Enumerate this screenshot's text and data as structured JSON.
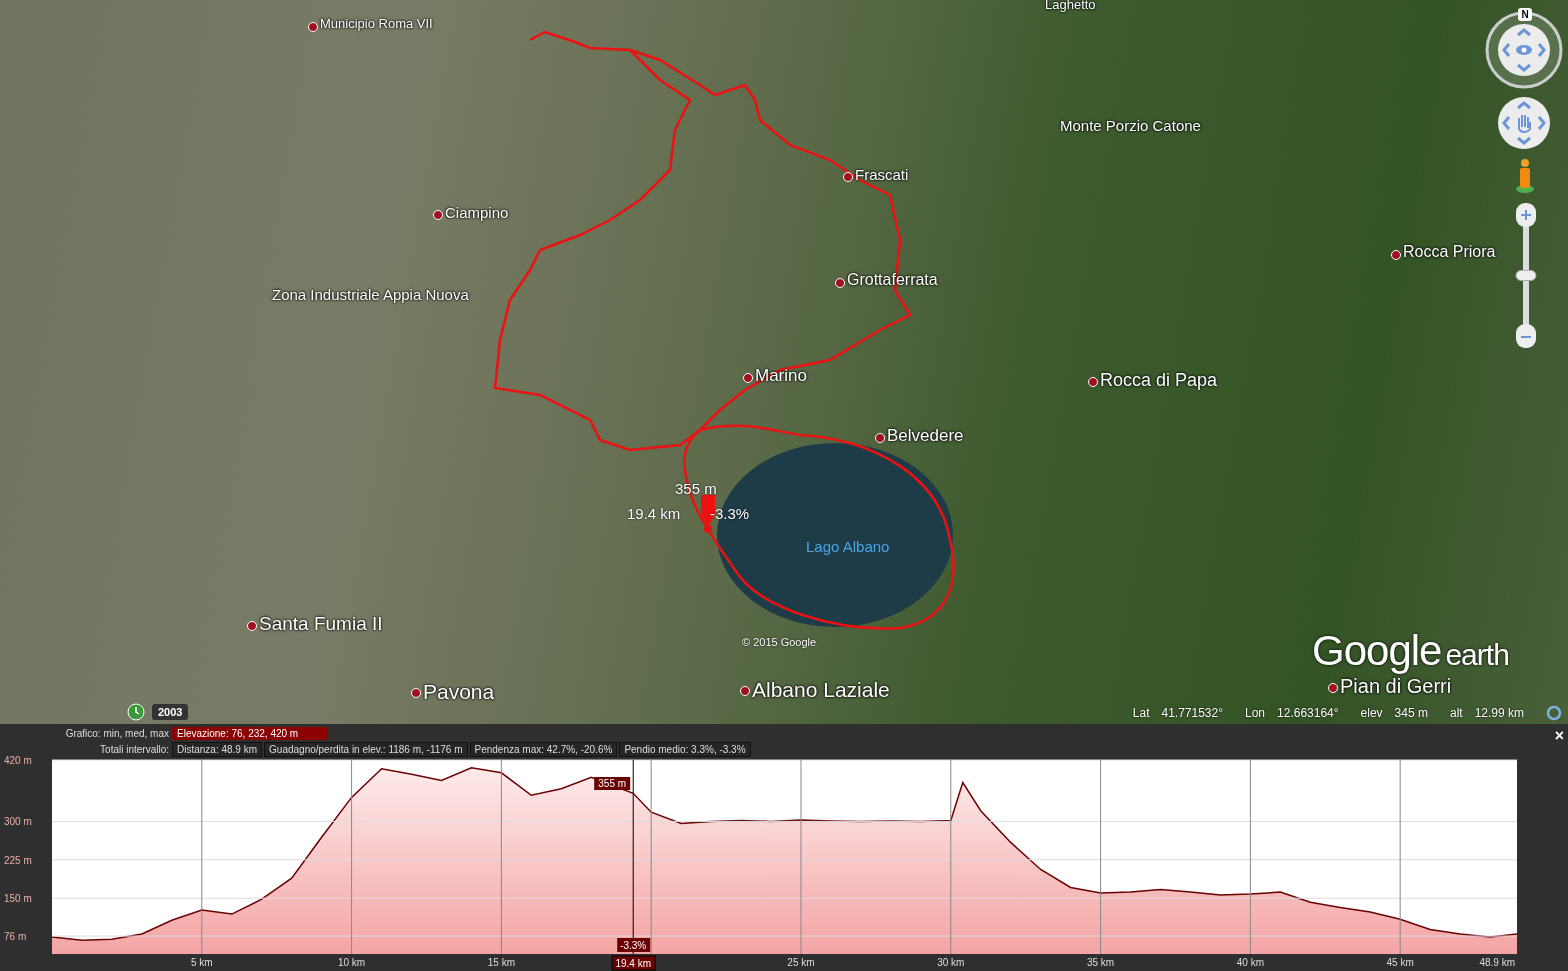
{
  "map": {
    "places": [
      {
        "name": "Laghetto",
        "kind": "locality"
      },
      {
        "name": "Municipio Roma VII",
        "kind": "town"
      },
      {
        "name": "Monte Porzio Catone",
        "kind": "locality"
      },
      {
        "name": "Frascati",
        "kind": "town"
      },
      {
        "name": "Ciampino",
        "kind": "town"
      },
      {
        "name": "Grottaferrata",
        "kind": "town"
      },
      {
        "name": "Rocca Priora",
        "kind": "town"
      },
      {
        "name": "Zona Industriale Appia Nuova",
        "kind": "locality"
      },
      {
        "name": "Marino",
        "kind": "town"
      },
      {
        "name": "Rocca di Papa",
        "kind": "town"
      },
      {
        "name": "Belvedere",
        "kind": "town"
      },
      {
        "name": "Lago Albano",
        "kind": "water"
      },
      {
        "name": "Santa Fumia II",
        "kind": "town"
      },
      {
        "name": "Pavona",
        "kind": "town"
      },
      {
        "name": "Albano Laziale",
        "kind": "town"
      },
      {
        "name": "Pian di Gerri",
        "kind": "town"
      }
    ],
    "marker": {
      "elevation": "355 m",
      "distance": "19.4 km",
      "slope": "-3.3%"
    },
    "zoom_slider": {
      "level": 0.5
    },
    "copyright": "© 2015 Google",
    "logo_word": "Google",
    "logo_suffix": "earth",
    "historical_year": "2003",
    "compass_letter": "N"
  },
  "status_bar": [
    {
      "label": "Lat",
      "value": "41.771532°"
    },
    {
      "label": "Lon",
      "value": "12.663164°"
    },
    {
      "label": "elev",
      "value": "345 m"
    },
    {
      "label": "alt",
      "value": "12.99 km"
    }
  ],
  "elevation_profile": {
    "graph_label": "Grafico: min, med, max",
    "graph_value": "Elevazione: 76, 232, 420 m",
    "totals_label": "Totali intervallo:",
    "totals": [
      "Distanza: 48.9 km",
      "Guadagno/perdita in elev.: 1186 m, -1176 m",
      "Pendenza max: 42.7%, -20.6%",
      "Pendio medio: 3.3%, -3.3%"
    ],
    "close": "×",
    "cursor": {
      "elevation": "355 m",
      "slope": "-3.3%",
      "distance": "19.4 km"
    },
    "chart_data": {
      "type": "area",
      "x": [
        0,
        1,
        2,
        3,
        4,
        5,
        6,
        7,
        8,
        9,
        10,
        11,
        12,
        13,
        14,
        15,
        16,
        17,
        18,
        19,
        19.4,
        20,
        21,
        22,
        23,
        24,
        25,
        26,
        27,
        28,
        29,
        30,
        30.4,
        31,
        32,
        33,
        34,
        35,
        36,
        37,
        38,
        39,
        40,
        41,
        42,
        43,
        44,
        45,
        46,
        47,
        48,
        48.9
      ],
      "series": [
        {
          "color": "#6b0000",
          "values": [
            74,
            68,
            70,
            80,
            107,
            127,
            119,
            148,
            189,
            269,
            347,
            403,
            392,
            380,
            405,
            395,
            351,
            364,
            386,
            364,
            355,
            318,
            296,
            300,
            302,
            300,
            303,
            301,
            300,
            301,
            300,
            302,
            376,
            321,
            259,
            206,
            171,
            160,
            162,
            167,
            162,
            156,
            158,
            162,
            142,
            132,
            123,
            109,
            89,
            80,
            74,
            80
          ]
        }
      ],
      "xlim": [
        0,
        48.9
      ],
      "ylim": [
        41,
        420
      ],
      "grid": true,
      "ref_lines": [
        {
          "axis": "x",
          "value": 19.4
        }
      ],
      "xticks": [
        {
          "value": 5,
          "label": "5 km"
        },
        {
          "value": 10,
          "label": "10 km"
        },
        {
          "value": 15,
          "label": "15 km"
        },
        {
          "value": 25,
          "label": "25 km"
        },
        {
          "value": 30,
          "label": "30 km"
        },
        {
          "value": 35,
          "label": "35 km"
        },
        {
          "value": 40,
          "label": "40 km"
        },
        {
          "value": 45,
          "label": "45 km"
        },
        {
          "value": 48.9,
          "label": "48.9 km"
        }
      ],
      "yticks": [
        {
          "value": 76,
          "label": "76 m"
        },
        {
          "value": 150,
          "label": "150 m"
        },
        {
          "value": 225,
          "label": "225 m"
        },
        {
          "value": 300,
          "label": "300 m"
        },
        {
          "value": 420,
          "label": "420 m"
        }
      ]
    }
  }
}
